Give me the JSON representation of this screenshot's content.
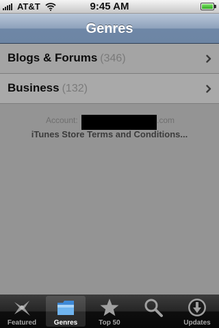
{
  "status_bar": {
    "carrier": "AT&T",
    "time": "9:45 AM",
    "battery_level": 1.0,
    "icons": [
      "signal-icon",
      "wifi-icon",
      "battery-icon"
    ]
  },
  "nav": {
    "title": "Genres"
  },
  "list": {
    "items": [
      {
        "label": "Blogs & Forums",
        "count": "(346)"
      },
      {
        "label": "Business",
        "count": "(132)"
      }
    ]
  },
  "footer": {
    "account_prefix": "Account:",
    "account_suffix": ".com",
    "terms": "iTunes Store Terms and Conditions..."
  },
  "tabbar": {
    "selected": "Genres",
    "items": [
      {
        "label": "Featured",
        "icon": "featured-icon"
      },
      {
        "label": "Genres",
        "icon": "genres-folder-icon"
      },
      {
        "label": "Top 50",
        "icon": "star-icon"
      },
      {
        "label": "",
        "icon": "search-icon"
      },
      {
        "label": "Updates",
        "icon": "download-arrow-icon"
      }
    ]
  },
  "colors": {
    "nav_bar": "#7189a8",
    "background": "#949494",
    "tab_bar": "#141414",
    "selected_tab_icon": "#5fa8e8"
  }
}
